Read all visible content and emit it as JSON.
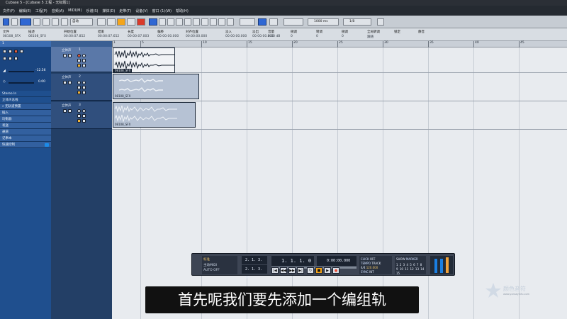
{
  "window": {
    "title": "Cubase 5 - [Cubase 5 工程 - 无标题1]"
  },
  "menu": [
    "文件(F)",
    "编辑(E)",
    "工程(P)",
    "音频(A)",
    "MIDI(M)",
    "乐谱(S)",
    "媒体(D)",
    "走带(T)",
    "设备(V)",
    "窗口 (1)(W)",
    "帮助(H)"
  ],
  "toolbar": {
    "mode_label": "自动",
    "snap_value": "1000 ms",
    "quantize_value": "1/8"
  },
  "info_line": {
    "columns": [
      {
        "label": "文件",
        "value": "08108_SFX"
      },
      {
        "label": "描述",
        "value": "08108_SFX"
      },
      {
        "label": "开始位置",
        "value": "00:00:07.852"
      },
      {
        "label": "结束",
        "value": "00:00:07.652"
      },
      {
        "label": "长度",
        "value": "00:00:07.003"
      },
      {
        "label": "偏移",
        "value": "00:00:00.000"
      },
      {
        "label": "对齐位置",
        "value": "00:00:00.000"
      },
      {
        "label": "淡入",
        "value": "00:00:00.000"
      },
      {
        "label": "淡出",
        "value": "00:00:00.000"
      },
      {
        "label": "音量",
        "value": "0.00 dB"
      },
      {
        "label": "微调",
        "value": "0"
      },
      {
        "label": "转调",
        "value": "0"
      },
      {
        "label": "微调",
        "value": "0"
      },
      {
        "label": "全局转调",
        "value": "跟随"
      },
      {
        "label": "锁定",
        "value": ""
      },
      {
        "label": "静音",
        "value": ""
      }
    ]
  },
  "inspector": {
    "track_number": "1",
    "volume_value": "-12.56",
    "pan_value": "0.00",
    "input": "Stereo In",
    "output": "立体声总线",
    "preset": "无轨道预置",
    "sections": [
      "插入",
      "均衡器",
      "发送",
      "通道",
      "记事本",
      "快速控制"
    ]
  },
  "tracks": [
    {
      "number": "1",
      "name": "立体声"
    },
    {
      "number": "2",
      "name": "立体声"
    },
    {
      "number": "3",
      "name": "立体声"
    }
  ],
  "ruler": {
    "labels": [
      "1",
      "5",
      "10",
      "15",
      "20",
      "25",
      "30",
      "35",
      "40",
      "45"
    ]
  },
  "events": [
    {
      "name": "08108_SFX"
    },
    {
      "name": "08108_SFX"
    },
    {
      "name": "08108_SFX"
    }
  ],
  "transport": {
    "track_label": "标准",
    "midi_label": "主动MIDI",
    "auto_label": "AUTO",
    "auto_state": "OFF",
    "left_locator": "2. 1. 3. 90",
    "right_locator": "2. 1. 3. 90",
    "position": "1. 1. 1. 0",
    "time": "0:00:00.000",
    "click": "CLICK",
    "click_state": "OFF",
    "tempo_label": "TEMPO",
    "tempo_state": "TRACK",
    "signature": "4/4",
    "tempo": "120.000",
    "sync": "SYNC",
    "sync_state": "INT",
    "marker": "MARKER",
    "show": "SHOW",
    "marker_numbers": "1 2 3 4 5 6 7 8 9 10 11 12 13 14 15"
  },
  "subtitle": "首先呢我们要先添加一个编组轨",
  "watermark": {
    "text": "颜色音符",
    "subtext": "www.yanseyinfu.com"
  }
}
